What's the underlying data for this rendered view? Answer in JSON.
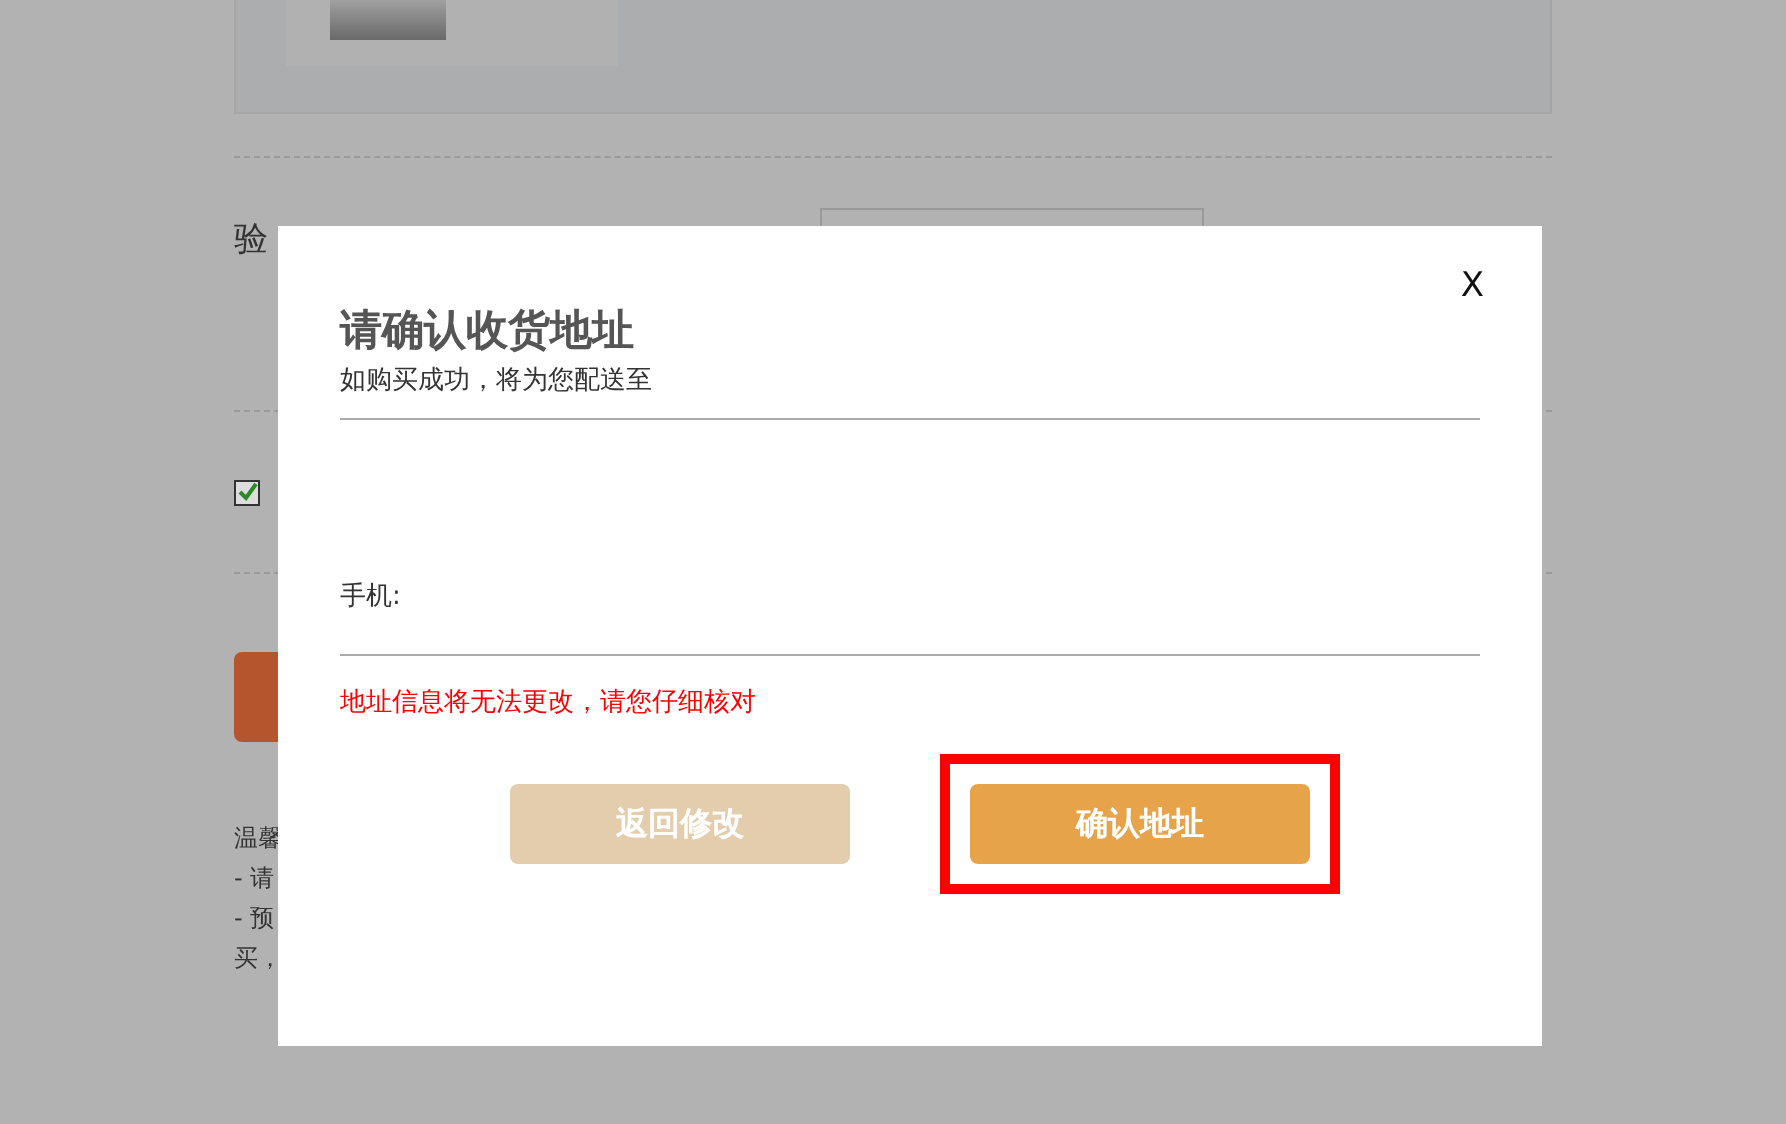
{
  "background_page": {
    "verify_label": "验",
    "agreement_checked": true,
    "tips": [
      "温馨",
      "- 请",
      "- 预",
      "买，"
    ]
  },
  "dialog": {
    "close": "X",
    "title": "请确认收货地址",
    "subtitle": "如购买成功，将为您配送至",
    "phone_label": "手机:",
    "warning": "地址信息将无法更改，请您仔细核对",
    "buttons": [
      {
        "label": "返回修改",
        "kind": "secondary",
        "highlighted": false
      },
      {
        "label": "确认地址",
        "kind": "primary",
        "highlighted": true
      }
    ]
  }
}
